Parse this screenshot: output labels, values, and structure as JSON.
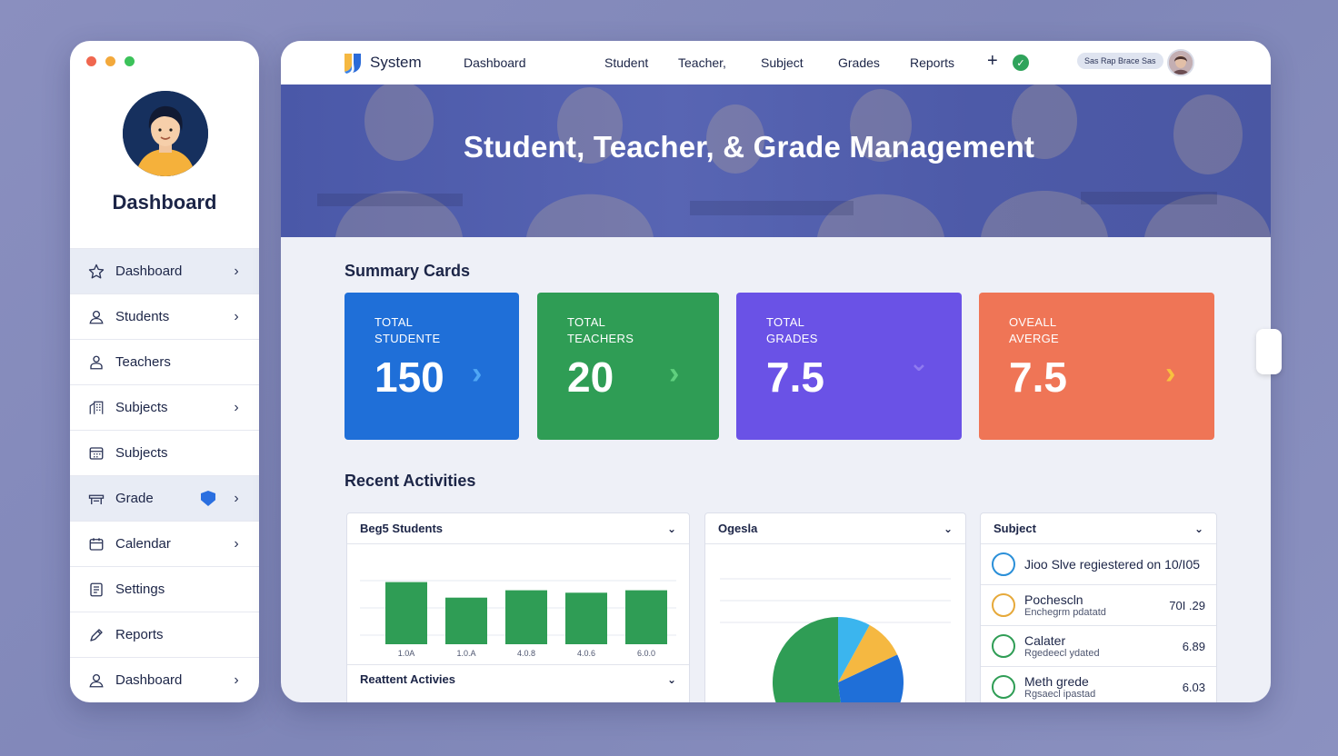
{
  "sidebar": {
    "title": "Dashboard",
    "items": [
      {
        "label": "Dashboard",
        "icon": "star-icon",
        "chevron": true,
        "active": true
      },
      {
        "label": "Students",
        "icon": "user-icon",
        "chevron": true,
        "active": false
      },
      {
        "label": "Teachers",
        "icon": "teacher-icon",
        "chevron": false,
        "active": false
      },
      {
        "label": "Subjects",
        "icon": "building-icon",
        "chevron": true,
        "active": false
      },
      {
        "label": "Subjects",
        "icon": "calendar-grid-icon",
        "chevron": false,
        "active": false
      },
      {
        "label": "Grade",
        "icon": "desk-icon",
        "chevron": true,
        "active": true,
        "badge": "shield"
      },
      {
        "label": "Calendar",
        "icon": "calendar-icon",
        "chevron": true,
        "active": false
      },
      {
        "label": "Settings",
        "icon": "document-icon",
        "chevron": false,
        "active": false
      },
      {
        "label": "Reports",
        "icon": "pencil-icon",
        "chevron": false,
        "active": false
      },
      {
        "label": "Dashboard",
        "icon": "user-icon",
        "chevron": true,
        "active": false
      }
    ]
  },
  "header": {
    "brand": "System",
    "nav": [
      "Dashboard",
      "Student",
      "Teacher,",
      "Subject",
      "Grades",
      "Reports"
    ],
    "user_pill": "Sas Rap Brace Sas"
  },
  "hero": {
    "title": "Student, Teacher, & Grade Management"
  },
  "summary": {
    "title": "Summary Cards",
    "cards": [
      {
        "label_line1": "TOTAL",
        "label_line2": "STUDENTE",
        "value": "150",
        "color": "#1f6fd8",
        "icon": "chevron-right-icon"
      },
      {
        "label_line1": "TOTAL",
        "label_line2": "TEACHERS",
        "value": "20",
        "color": "#2f9d55",
        "icon": "chevron-right-icon"
      },
      {
        "label_line1": "TOTAL",
        "label_line2": "GRADES",
        "value": "7.5",
        "color": "#6a52e6",
        "icon": "chevron-down-icon"
      },
      {
        "label_line1": "OVEALL",
        "label_line2": "AVERGE",
        "value": "7.5",
        "color": "#ef7556",
        "icon": "chevron-right-icon"
      }
    ]
  },
  "recent": {
    "title": "Recent Activities",
    "bar_panel": {
      "title": "Beg5 Students",
      "footer": "Reattent Activies",
      "chart_data": {
        "type": "bar",
        "categories": [
          "1.0A",
          "1.0.A",
          "4.0.8",
          "4.0.6",
          "6.0.0"
        ],
        "values": [
          76,
          57,
          66,
          63,
          66
        ],
        "ylim": [
          0,
          100
        ],
        "color": "#2f9d55"
      }
    },
    "pie_panel": {
      "title": "Ogesla",
      "chart_data": {
        "type": "pie",
        "values": [
          52,
          30,
          10,
          8
        ],
        "colors": [
          "#2f9d55",
          "#1f6fd8",
          "#f5b841",
          "#3bb5ee"
        ]
      }
    },
    "subject_panel": {
      "title": "Subject",
      "rows": [
        {
          "title": "Jioo Slve regiestered on 10/I05",
          "sub": "",
          "value": "",
          "icon_color": "#2a8fd8"
        },
        {
          "title": "Pochescln",
          "sub": "Enchegrm pdatatd",
          "value": "70I .29",
          "icon_color": "#e6a93a"
        },
        {
          "title": "Calater",
          "sub": "Rgedeecl ydated",
          "value": "6.89",
          "icon_color": "#2f9d55"
        },
        {
          "title": "Meth grede",
          "sub": "Rgsaecl ipastad",
          "value": "6.03",
          "icon_color": "#2f9d55"
        }
      ]
    }
  }
}
